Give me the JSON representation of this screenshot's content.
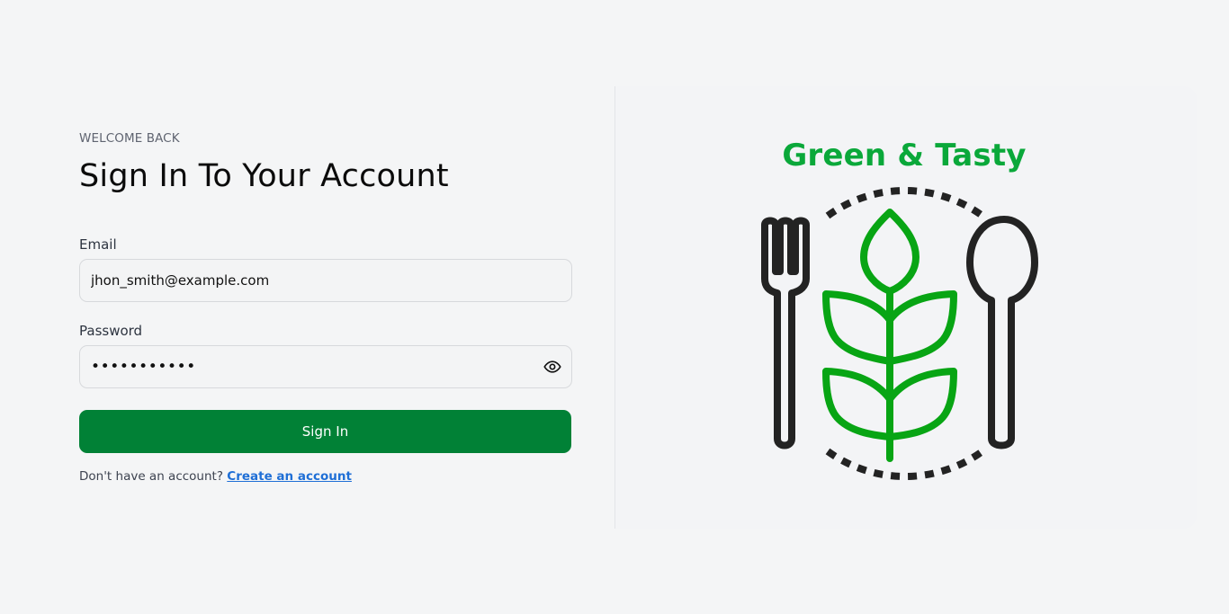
{
  "login": {
    "eyebrow": "WELCOME BACK",
    "title": "Sign In To Your Account",
    "email": {
      "label": "Email",
      "value": "jhon_smith@example.com"
    },
    "password": {
      "label": "Password",
      "masked_value": "•••••••••••"
    },
    "submit_label": "Sign In",
    "signup_prompt": "Don't have an account?",
    "signup_link": "Create an account"
  },
  "brand": {
    "name": "Green & Tasty",
    "color": "#0aa83a",
    "logo_icon": "fork-leaf-spoon-logo"
  },
  "colors": {
    "primary_button": "#018136",
    "link": "#1f6fd6",
    "leaf": "#08a514",
    "utensils": "#232323"
  }
}
